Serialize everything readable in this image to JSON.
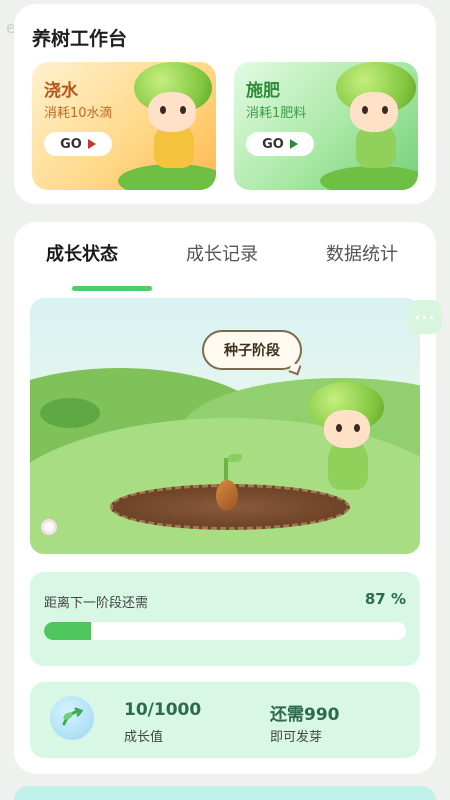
{
  "watermark": "e0",
  "workbench": {
    "title": "养树工作台",
    "actions": [
      {
        "name": "浇水",
        "subtitle": "消耗10水滴",
        "button": "GO"
      },
      {
        "name": "施肥",
        "subtitle": "消耗1肥料",
        "button": "GO"
      }
    ]
  },
  "tabs": [
    {
      "label": "成长状态",
      "active": true
    },
    {
      "label": "成长记录",
      "active": false
    },
    {
      "label": "数据统计",
      "active": false
    }
  ],
  "scene": {
    "stage_label": "种子阶段"
  },
  "more_button": "···",
  "progress": {
    "label": "距离下一阶段还需",
    "percent_text": "87 %",
    "fill_fraction": 0.13
  },
  "stats": {
    "growth_value": "10/1000",
    "growth_caption": "成长值",
    "remaining_value": "还需990",
    "remaining_caption": "即可发芽"
  },
  "colors": {
    "accent": "#4ccf6a",
    "progress_fill": "#4fc55e",
    "stat_text": "#2d6a4f"
  }
}
